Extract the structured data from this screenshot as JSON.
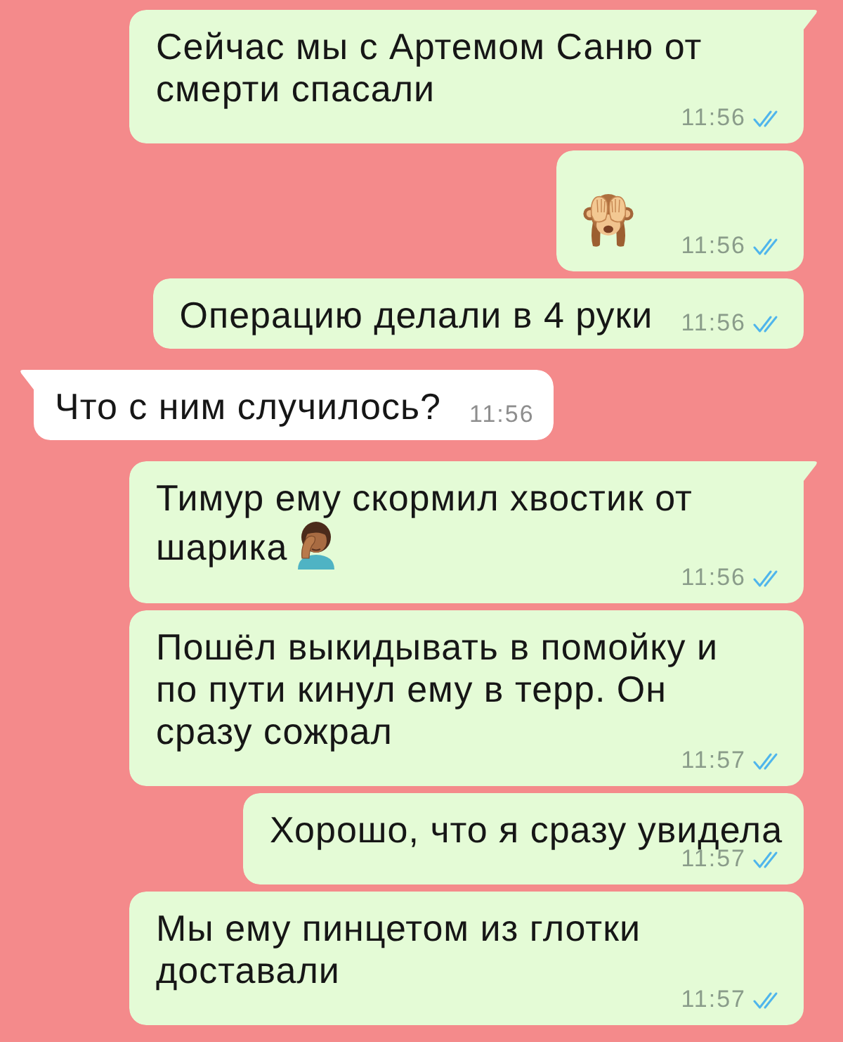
{
  "chat": {
    "messages": [
      {
        "outgoing": true,
        "kind": "text",
        "tail": true,
        "text": "Сейчас мы с Артемом Саню от смерти спасали",
        "trailing_emoji": false,
        "time": "11:56",
        "read": true
      },
      {
        "outgoing": true,
        "kind": "emoji",
        "tail": false,
        "trailing_emoji": false,
        "time": "11:56",
        "read": true
      },
      {
        "outgoing": true,
        "kind": "text",
        "tail": false,
        "text": "Операцию делали в 4 руки",
        "trailing_emoji": false,
        "time": "11:56",
        "read": true
      },
      {
        "outgoing": false,
        "kind": "text",
        "tail": true,
        "text": "Что с ним случилось?",
        "trailing_emoji": false,
        "time": "11:56"
      },
      {
        "outgoing": true,
        "kind": "text",
        "tail": true,
        "text": "Тимур ему скормил хвостик от шарика",
        "trailing_emoji": true,
        "time": "11:56",
        "read": true
      },
      {
        "outgoing": true,
        "kind": "text",
        "tail": false,
        "text": "Пошёл выкидывать в помойку и по пути кинул ему в терр. Он сразу сожрал",
        "trailing_emoji": false,
        "time": "11:57",
        "read": true
      },
      {
        "outgoing": true,
        "kind": "text",
        "tail": false,
        "text": "Хорошо, что я сразу увидела",
        "trailing_emoji": false,
        "time": "11:57",
        "read": true
      },
      {
        "outgoing": true,
        "kind": "text",
        "tail": false,
        "text": "Мы ему пинцетом из глотки доставали",
        "trailing_emoji": false,
        "time": "11:57",
        "read": true
      }
    ]
  }
}
